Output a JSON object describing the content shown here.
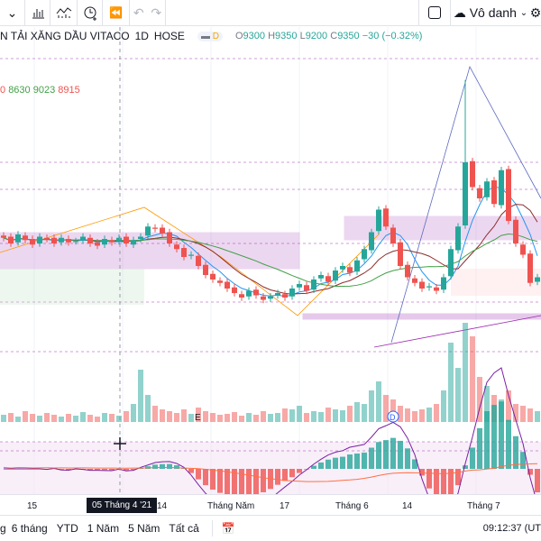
{
  "toolbar": {
    "account_label": "Vô danh"
  },
  "legend": {
    "symbol": "N TẢI XĂNG DẦU VITACO",
    "interval": "1D",
    "exchange": "HOSE",
    "badge": "D",
    "open": "9300",
    "high": "9350",
    "low": "9200",
    "close": "9350",
    "change": "−30 (−0.32%)",
    "o": "O",
    "h": "H",
    "l": "L",
    "c": "C"
  },
  "indicator_values": [
    "0",
    "8630",
    "9023",
    "8915"
  ],
  "markers": {
    "earnings": "E",
    "dividend": "D"
  },
  "time_axis": {
    "labels": [
      "15",
      "14",
      "Tháng Năm",
      "17",
      "Tháng 6",
      "14",
      "Tháng 7"
    ],
    "crosshair_label": "05 Tháng 4 '21"
  },
  "bottom_bar": {
    "ranges": [
      "g",
      "6 tháng",
      "YTD",
      "1 Năm",
      "5 Năm",
      "Tất cả"
    ],
    "clock": "09:12:37 (UT"
  },
  "colors": {
    "up": "#26a69a",
    "down": "#ef5350",
    "zone": "#9c27b0"
  },
  "chart_data": {
    "type": "candlestick",
    "closes": [
      9050,
      9000,
      9080,
      9030,
      8990,
      9060,
      9040,
      9000,
      9050,
      9010,
      9020,
      9060,
      9000,
      8980,
      9040,
      9010,
      9050,
      9000,
      9030,
      9060,
      9150,
      9130,
      9090,
      9000,
      8950,
      8880,
      8900,
      8800,
      8720,
      8680,
      8650,
      8600,
      8560,
      8520,
      8580,
      8540,
      8500,
      8530,
      8560,
      8520,
      8600,
      8640,
      8580,
      8680,
      8720,
      8660,
      8760,
      8800,
      8740,
      8850,
      8950,
      9100,
      9300,
      9150,
      9000,
      8800,
      8700,
      8650,
      8600,
      8620,
      8580,
      8700,
      8950,
      9150,
      9720,
      9500,
      9400,
      9550,
      9350,
      9650,
      9200,
      9000,
      8900,
      8650,
      8700
    ],
    "spike": {
      "index": 64,
      "high": 10450
    },
    "volumes": [
      8,
      10,
      6,
      12,
      9,
      7,
      10,
      8,
      6,
      9,
      7,
      11,
      8,
      6,
      10,
      9,
      7,
      12,
      20,
      58,
      30,
      18,
      14,
      12,
      10,
      14,
      9,
      16,
      12,
      10,
      8,
      9,
      11,
      7,
      10,
      8,
      12,
      9,
      10,
      15,
      14,
      18,
      10,
      12,
      11,
      16,
      14,
      13,
      18,
      22,
      20,
      35,
      45,
      30,
      25,
      18,
      15,
      12,
      14,
      16,
      20,
      35,
      88,
      60,
      110,
      95,
      50,
      40,
      30,
      25,
      35,
      20,
      18,
      15,
      12
    ]
  }
}
